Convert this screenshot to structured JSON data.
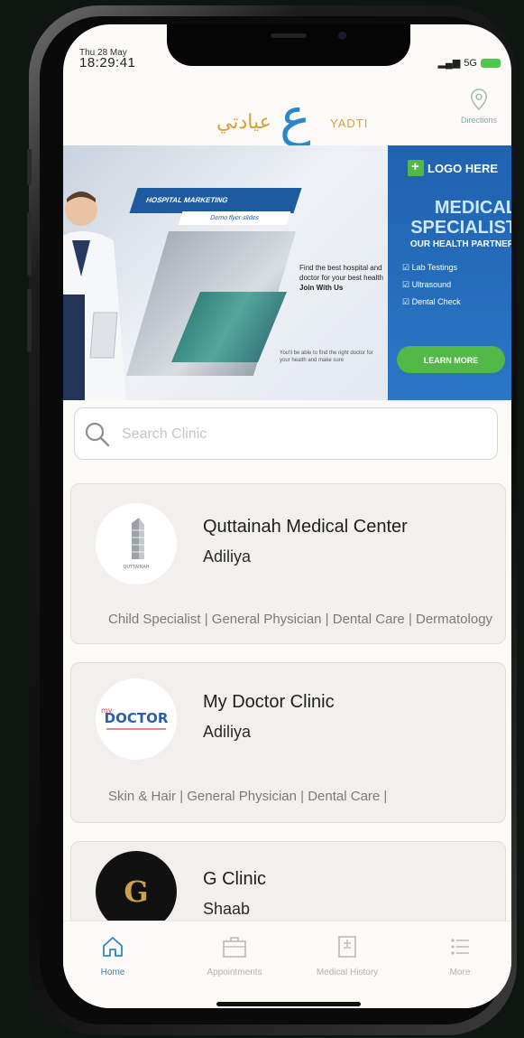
{
  "status_bar": {
    "date": "Thu 28 May",
    "time": "18:29:41",
    "network": "5G"
  },
  "header": {
    "logo_arabic": "عيادتي",
    "logo_ain": "ع",
    "logo_english": "YADTI",
    "directions_label": "Directions"
  },
  "banner": {
    "strip_title": "HOSPITAL MARKETING",
    "strip_subtitle": "Demo flyer slides",
    "mid_text": "Find the best hospital and doctor for your best health",
    "mid_bold": "Join With Us",
    "mid_small": "You'll be able to find the right doctor for your health and make sure",
    "logo_here": "LOGO HERE",
    "heading": "MEDICAL SPECIALIST",
    "subheading": "OUR HEALTH PARTNER",
    "bullets": [
      "Lab Testings",
      "Ultrasound",
      "Dental Check"
    ],
    "learn_more": "LEARN MORE"
  },
  "search": {
    "placeholder": "Search Clinic",
    "value": ""
  },
  "clinics": [
    {
      "name": "Quttainah Medical Center",
      "location": "Adiliya",
      "specialties": "Child Specialist | General Physician | Dental Care | Dermatology",
      "logo_text": "QUTTAINAH"
    },
    {
      "name": "My Doctor Clinic",
      "location": "Adiliya",
      "specialties": "Skin & Hair | General Physician | Dental Care |",
      "logo_text": "DOCTOR",
      "logo_prefix": "my"
    },
    {
      "name": "G Clinic",
      "location": "Shaab",
      "specialties": "",
      "logo_text": "G"
    }
  ],
  "tabbar": [
    {
      "label": "Home",
      "icon": "home-icon",
      "active": true
    },
    {
      "label": "Appointments",
      "icon": "briefcase-icon",
      "active": false
    },
    {
      "label": "Medical History",
      "icon": "document-icon",
      "active": false
    },
    {
      "label": "More",
      "icon": "list-icon",
      "active": false
    }
  ],
  "colors": {
    "accent": "#2d86c9",
    "gold": "#d3a23a",
    "banner_blue": "#1f62b0",
    "green": "#52b848"
  }
}
